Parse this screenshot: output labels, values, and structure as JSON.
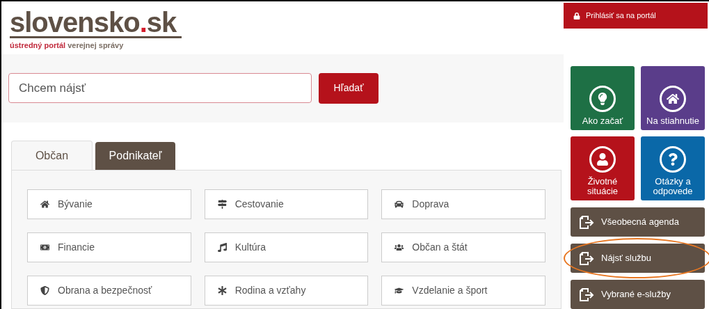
{
  "header": {
    "logo": {
      "main": "slovensko",
      "accent": ".",
      "suffix": "sk"
    },
    "tagline": {
      "highlight": "ústredný portál",
      "rest": "verejnej správy"
    }
  },
  "login": {
    "label": "Prihlásiť sa na portál"
  },
  "search": {
    "placeholder": "Chcem nájsť",
    "button": "Hľadať"
  },
  "tabs": [
    {
      "label": "Občan",
      "selected": true
    },
    {
      "label": "Podnikateľ",
      "selected": false
    }
  ],
  "categories": [
    {
      "label": "Bývanie"
    },
    {
      "label": "Cestovanie"
    },
    {
      "label": "Doprava"
    },
    {
      "label": "Financie"
    },
    {
      "label": "Kultúra"
    },
    {
      "label": "Občan a štát"
    },
    {
      "label": "Obrana a bezpečnosť"
    },
    {
      "label": "Rodina a vzťahy"
    },
    {
      "label": "Vzdelanie a šport"
    }
  ],
  "tiles": [
    {
      "label": "Ako začať",
      "color": "#1e7045"
    },
    {
      "label": "Na stiahnutie",
      "color": "#5a3d8a"
    },
    {
      "label": "Životné situácie",
      "color": "#b5121b"
    },
    {
      "label": "Otázky a odpovede",
      "color": "#0a68a8"
    }
  ],
  "actions": [
    {
      "label": "Všeobecná agenda",
      "highlighted": false
    },
    {
      "label": "Nájsť službu",
      "highlighted": true
    },
    {
      "label": "Vybrané e-služby",
      "highlighted": false
    }
  ]
}
